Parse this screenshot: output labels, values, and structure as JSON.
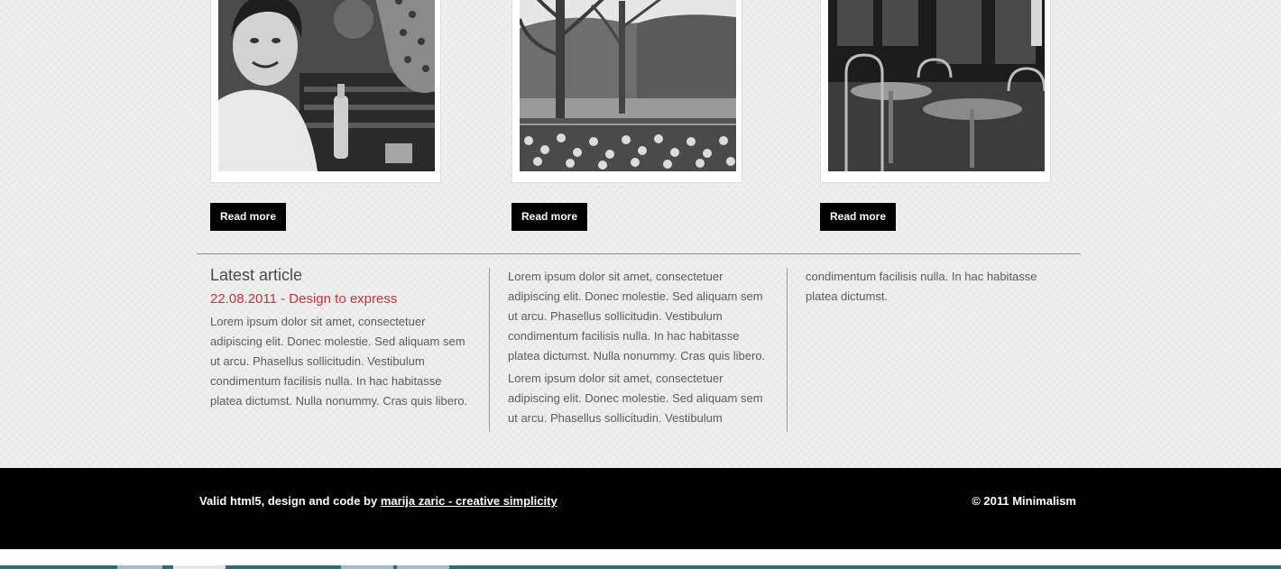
{
  "gallery": {
    "items": [
      {
        "button_label": "Read more",
        "photo": "woman-laughing-photo"
      },
      {
        "button_label": "Read more",
        "photo": "park-lake-photo"
      },
      {
        "button_label": "Read more",
        "photo": "cafe-terrace-photo"
      }
    ]
  },
  "latest": {
    "heading": "Latest article",
    "meta": "22.08.2011 - Design to express",
    "col1": [
      "Lorem ipsum dolor sit amet, consectetuer adipiscing elit. Donec molestie. Sed aliquam sem ut arcu. Phasellus sollicitudin. Vestibulum condimentum facilisis nulla. In hac habitasse platea dictumst. Nulla nonummy. Cras quis libero."
    ],
    "col2": [
      "Lorem ipsum dolor sit amet, consectetuer adipiscing elit. Donec molestie. Sed aliquam sem ut arcu. Phasellus sollicitudin. Vestibulum condimentum facilisis nulla. In hac habitasse platea dictumst. Nulla nonummy. Cras quis libero.",
      "Lorem ipsum dolor sit amet, consectetuer adipiscing elit. Donec molestie. Sed aliquam sem ut arcu. Phasellus sollicitudin. Vestibulum"
    ],
    "col3": [
      "condimentum facilisis nulla. In hac habitasse platea dictumst."
    ]
  },
  "footer": {
    "credit_prefix": "Valid html5, design and code by",
    "credit_link": "marija zaric - creative simplicity",
    "copyright": "© 2011 Minimalism"
  },
  "colors": {
    "accent": "#c0343a",
    "footer_bg": "#000000",
    "button_bg": "#000000",
    "page_bg": "#efefef"
  }
}
